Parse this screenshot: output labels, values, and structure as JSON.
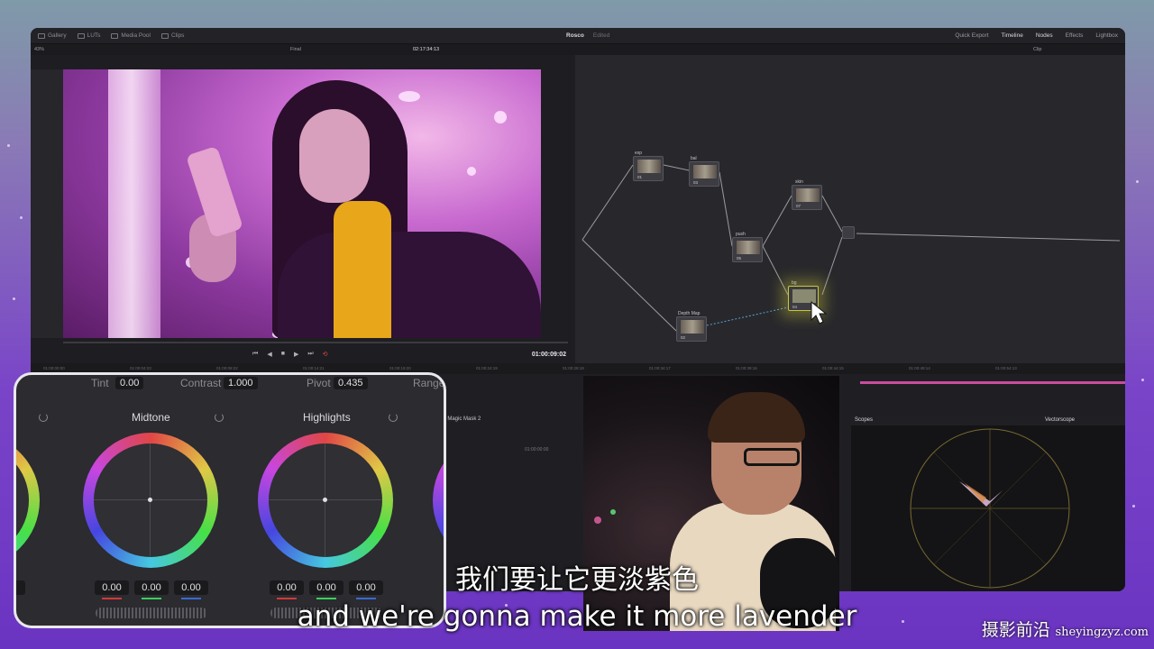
{
  "app": {
    "project_name": "Rosco",
    "project_status": "Edited",
    "top_left_tabs": [
      "Gallery",
      "LUTs",
      "Media Pool",
      "Clips"
    ],
    "top_right_tabs": [
      "Quick Export",
      "Timeline",
      "Nodes",
      "Effects",
      "Lightbox"
    ],
    "zoom": "43%",
    "viewer_mode": "Final",
    "source_timecode": "02:17:34:13",
    "record_timecode": "01:00:09:02",
    "node_mode": "Clip"
  },
  "nodes": [
    {
      "label": "exp",
      "num": "01"
    },
    {
      "label": "bal",
      "num": "03"
    },
    {
      "label": "push",
      "num": "05"
    },
    {
      "label": "skin",
      "num": "07"
    },
    {
      "label": "bg",
      "num": "04"
    },
    {
      "label": "Depth Map",
      "num": "02"
    }
  ],
  "timeline_ticks": [
    "01:00:00:00",
    "01:00:04:23",
    "01:00:09:22",
    "01:00:14:21",
    "01:00:19:20",
    "01:00:24:19",
    "01:00:29:18",
    "01:00:34:17",
    "01:00:39:16",
    "01:00:44:15",
    "01:00:49:14",
    "01:00:54:13"
  ],
  "magic_mask": {
    "label": "al Magic Mask 2",
    "tc": "01:00:00:00"
  },
  "scopes": {
    "title": "Scopes",
    "mode": "Vectorscope"
  },
  "color_panel": {
    "tint_label": "Tint",
    "tint_value": "0.00",
    "contrast_label": "Contrast",
    "contrast_value": "1.000",
    "pivot_label": "Pivot",
    "pivot_value": "0.435",
    "range_label": "Range",
    "wheels": [
      {
        "name": "Midtone",
        "values": [
          "0.00",
          "0.00",
          "0.00"
        ]
      },
      {
        "name": "Highlights",
        "values": [
          "0.00",
          "0.00",
          "0.00"
        ]
      }
    ],
    "left_partial_value": "0"
  },
  "subtitles": {
    "chinese": "我们要让它更淡紫色",
    "english": "and we're gonna make it more lavender"
  },
  "watermark": {
    "chinese": "摄影前沿",
    "latin": "sheyingzyz.com"
  },
  "colors": {
    "accent_pink": "#c94c9e",
    "bg_purple": "#7a44c8",
    "node_selected": "#c8c640"
  }
}
